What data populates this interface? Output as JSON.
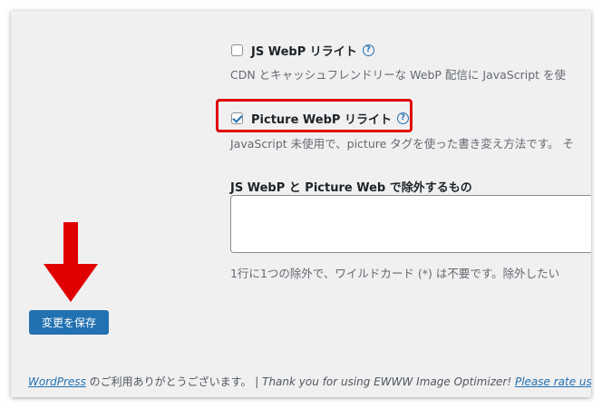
{
  "options": {
    "js_webp": {
      "label": "JS WebP リライト",
      "checked": false,
      "description": "CDN とキャッシュフレンドリーな WebP 配信に JavaScript を使"
    },
    "picture_webp": {
      "label": "Picture WebP リライト",
      "checked": true,
      "description": "JavaScript 未使用で、picture タグを使った書き変え方法です。 そ"
    }
  },
  "exclusions": {
    "title": "JS WebP と Picture Web で除外するもの",
    "value": "",
    "help_text": "1行に1つの除外で、ワイルドカード (*) は不要です。除外したい"
  },
  "help_icon_glyph": "?",
  "save_button": {
    "label": "変更を保存"
  },
  "footer": {
    "wordpress_link": "WordPress",
    "jp_text": " のご利用ありがとうございます。",
    "separator": " | ",
    "thanks": "Thank you for using EWWW Image Optimizer! ",
    "rate_link": "Please rate us o"
  },
  "colors": {
    "accent": "#2271b1",
    "highlight": "#e00000",
    "background": "#f0f0f1"
  },
  "icons": [
    "checkbox-icon",
    "help-icon",
    "red-down-arrow-icon"
  ]
}
